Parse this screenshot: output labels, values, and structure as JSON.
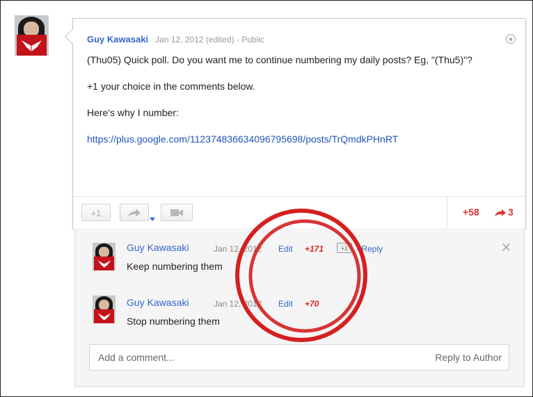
{
  "post": {
    "author": "Guy Kawasaki",
    "meta": "Jan 12, 2012 (edited)  -  Public",
    "body_lines": [
      "(Thu05) Quick poll. Do you want me to continue numbering my daily posts? Eg, \"(Thu5)\"?",
      "+1 your choice in the comments below.",
      "Here's why I number:"
    ],
    "link": "https://plus.google.com/112374836634096795698/posts/TrQmdkPHnRT",
    "plus_one_label": "+1",
    "plus_count": "+58",
    "share_count": "3"
  },
  "comments": [
    {
      "author": "Guy Kawasaki",
      "date": "Jan 12, 2012",
      "edit": "Edit",
      "score": "+171",
      "plus_label": "+1",
      "reply": "- Reply",
      "text": "Keep numbering them"
    },
    {
      "author": "Guy Kawasaki",
      "date": "Jan 12, 2012",
      "edit": "Edit",
      "score": "+70",
      "text": "Stop numbering them"
    }
  ],
  "add_comment": {
    "placeholder": "Add a comment...",
    "reply_to_author": "Reply to Author"
  },
  "colors": {
    "link": "#3366cc",
    "plus_red": "#dd3333",
    "annotation_red": "#d42020"
  },
  "icons": [
    "share-arrow-icon",
    "video-camera-icon",
    "menu-dropdown-icon",
    "close-icon"
  ]
}
